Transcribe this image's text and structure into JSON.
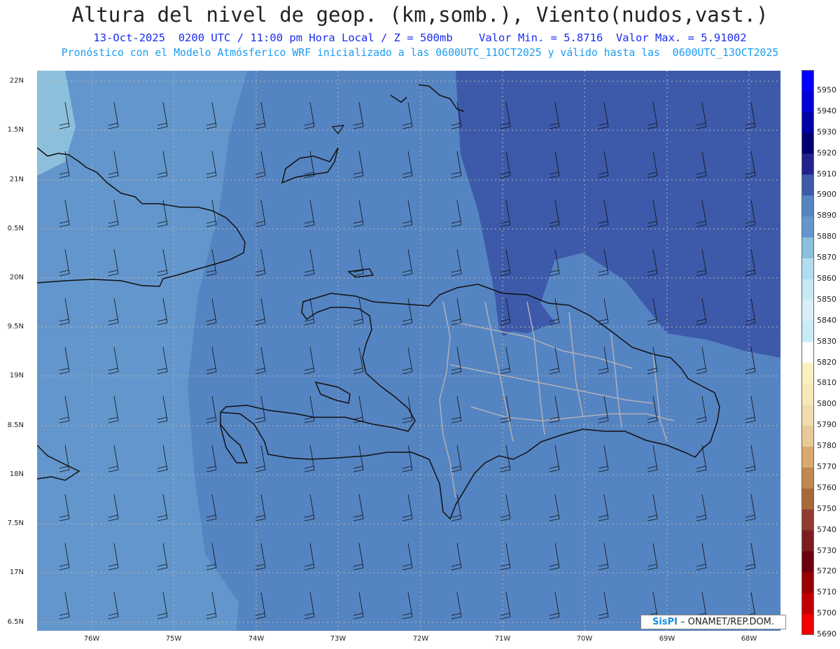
{
  "header": {
    "title": "Altura del nivel de geop. (km,somb.), Viento(nudos,vast.)",
    "line1": "13-Oct-2025  0200 UTC / 11:00 pm Hora Local / Z = 500mb    Valor Min. = 5.8716  Valor Max. = 5.91002",
    "line2": "Pronóstico con el Modelo Atmósferico WRF inicializado a las 0600UTC_11OCT2025 y válido hasta las  0600UTC_13OCT2025"
  },
  "map": {
    "lat_labels": [
      "22N",
      "1.5N",
      "21N",
      "0.5N",
      "20N",
      "9.5N",
      "19N",
      "8.5N",
      "18N",
      "7.5N",
      "17N",
      "6.5N"
    ],
    "lon_labels": [
      "76W",
      "75W",
      "74W",
      "73W",
      "72W",
      "71W",
      "70W",
      "69W",
      "68W"
    ],
    "colors": {
      "field_5870": "#8cbfdc",
      "field_5880": "#6396cc",
      "field_5890": "#5584c2",
      "field_5900": "#3d5aaa",
      "coast": "#111111",
      "provinces": "#b0b0b8",
      "grid": "#b8b8b8"
    }
  },
  "colorbar": {
    "labels": [
      "5950",
      "5940",
      "5930",
      "5920",
      "5910",
      "5900",
      "5890",
      "5880",
      "5870",
      "5860",
      "5850",
      "5840",
      "5830",
      "5820",
      "5810",
      "5800",
      "5790",
      "5780",
      "5770",
      "5760",
      "5750",
      "5740",
      "5730",
      "5720",
      "5710",
      "5700",
      "5690"
    ],
    "colors": [
      "#0000ff",
      "#0000d8",
      "#0000a8",
      "#000070",
      "#22228c",
      "#3d5aaa",
      "#5584c2",
      "#6396cc",
      "#8cbfdc",
      "#b2ddf0",
      "#c8e8f4",
      "#d8eef8",
      "#c8ecf8",
      "#ffffff",
      "#fbefc0",
      "#f8e8b8",
      "#f0dcb0",
      "#e8ca98",
      "#d8aa70",
      "#c08850",
      "#a86838",
      "#903c30",
      "#7c1c20",
      "#6c0010",
      "#9a0000",
      "#c00000",
      "#f00000"
    ]
  },
  "credit": {
    "logo": "SisPI",
    "text": "– ONAMET/REP.DOM."
  }
}
